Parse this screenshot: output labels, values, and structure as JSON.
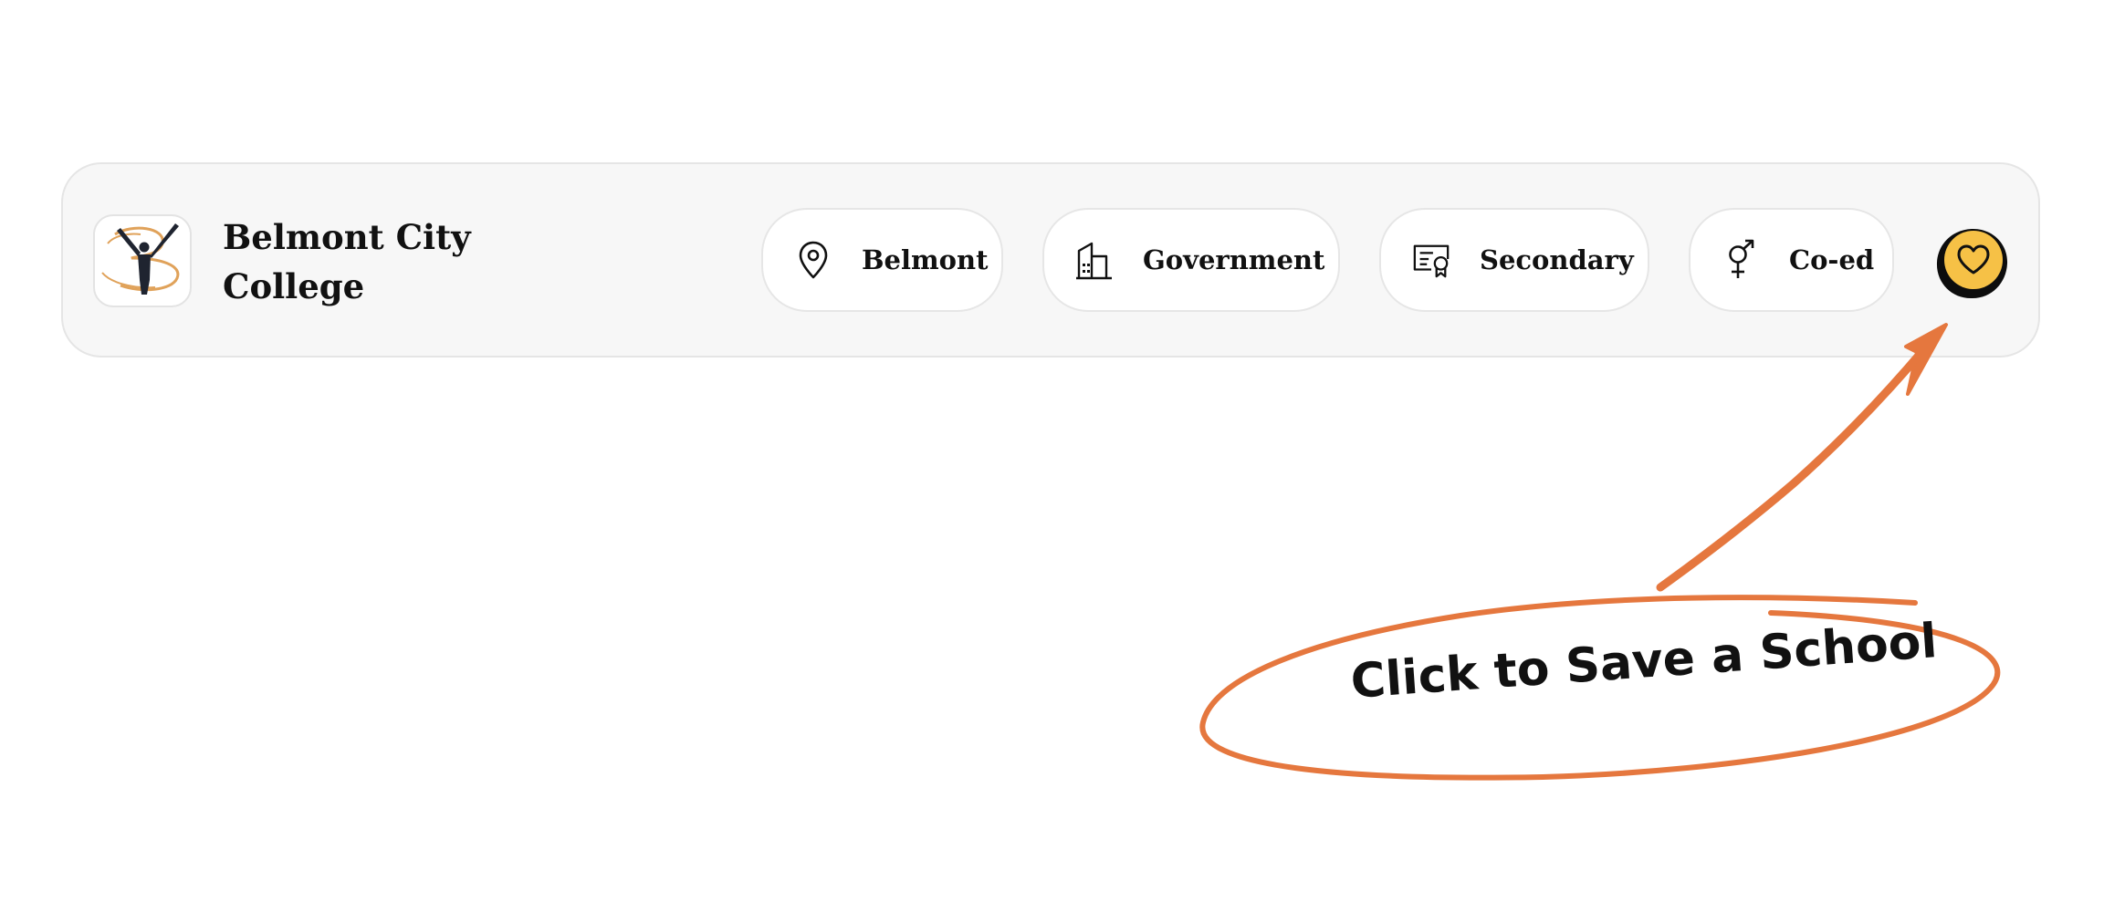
{
  "school": {
    "name": "Belmont City College",
    "logo_icon": "belmont-city-college-logo"
  },
  "tags": [
    {
      "label": "Belmont",
      "icon": "map-pin-icon"
    },
    {
      "label": "Government",
      "icon": "building-icon"
    },
    {
      "label": "Secondary",
      "icon": "certificate-icon"
    },
    {
      "label": "Co-ed",
      "icon": "gender-icon"
    }
  ],
  "save": {
    "icon": "heart-icon",
    "color": "#f6c146"
  },
  "annotation": {
    "text": "Click to Save a School",
    "color": "#e5773e"
  },
  "colors": {
    "card_background": "#f7f7f7",
    "pill_background": "#ffffff",
    "text": "#111111"
  }
}
